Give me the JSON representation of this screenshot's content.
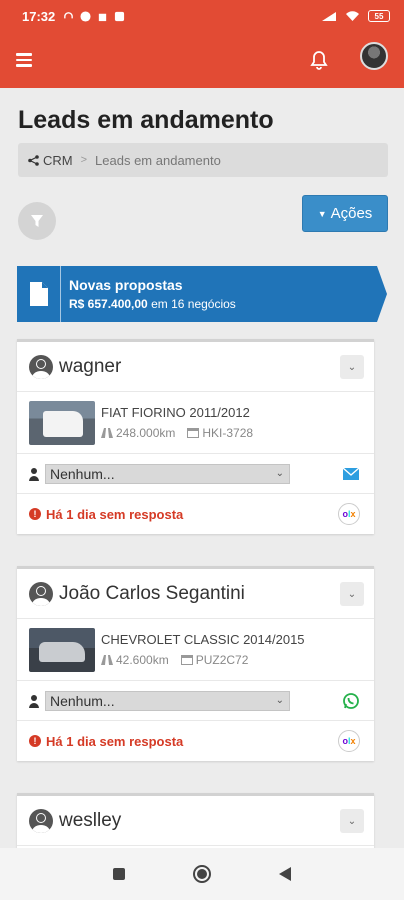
{
  "status_bar": {
    "time": "17:32",
    "battery": "55"
  },
  "header": {
    "title": "Leads em andamento"
  },
  "breadcrumb": {
    "root": "CRM",
    "separator": ">",
    "current": "Leads em andamento"
  },
  "toolbar": {
    "actions_label": "Ações"
  },
  "proposals": {
    "title": "Novas propostas",
    "amount": "R$ 657.400,00",
    "suffix": "em 16 negócios"
  },
  "leads": [
    {
      "name": "wagner",
      "vehicle": "FIAT FIORINO 2011/2012",
      "km": "248.000km",
      "plate": "HKI-3728",
      "assignee": "Nenhum...",
      "contact_icon": "email-icon",
      "status": "Há 1 dia sem resposta",
      "source": "olx"
    },
    {
      "name": "João Carlos Segantini",
      "vehicle": "CHEVROLET CLASSIC 2014/2015",
      "km": "42.600km",
      "plate": "PUZ2C72",
      "assignee": "Nenhum...",
      "contact_icon": "whatsapp-icon",
      "status": "Há 1 dia sem resposta",
      "source": "olx"
    },
    {
      "name": "weslley"
    }
  ],
  "colors": {
    "brand": "#e24b34",
    "primary": "#3a8ec9",
    "proposals": "#2074b8",
    "warning": "#d53a25"
  }
}
